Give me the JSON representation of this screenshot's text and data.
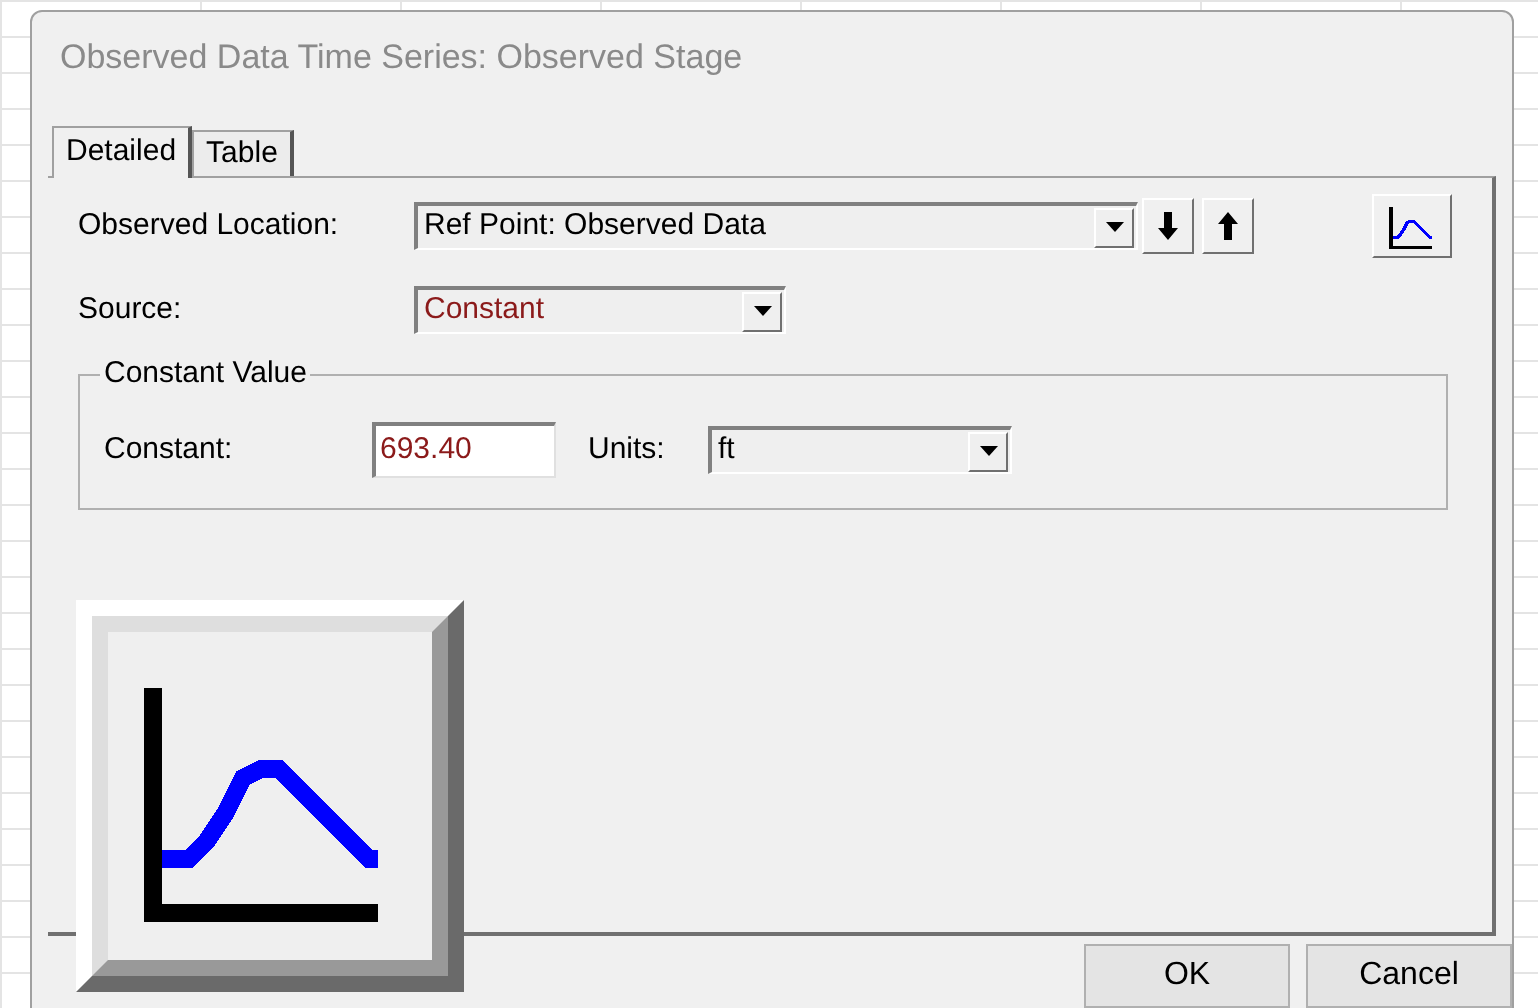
{
  "window": {
    "title": "Observed Data Time Series: Observed Stage"
  },
  "tabs": [
    {
      "label": "Detailed",
      "selected": true
    },
    {
      "label": "Table",
      "selected": false
    }
  ],
  "observed_location": {
    "label": "Observed Location:",
    "value": "Ref Point: Observed Data"
  },
  "source": {
    "label": "Source:",
    "value": "Constant"
  },
  "constant_group": {
    "title": "Constant Value",
    "constant_label": "Constant:",
    "constant_value": "693.40",
    "units_label": "Units:",
    "units_value": "ft"
  },
  "buttons": [
    "OK",
    "Cancel"
  ]
}
